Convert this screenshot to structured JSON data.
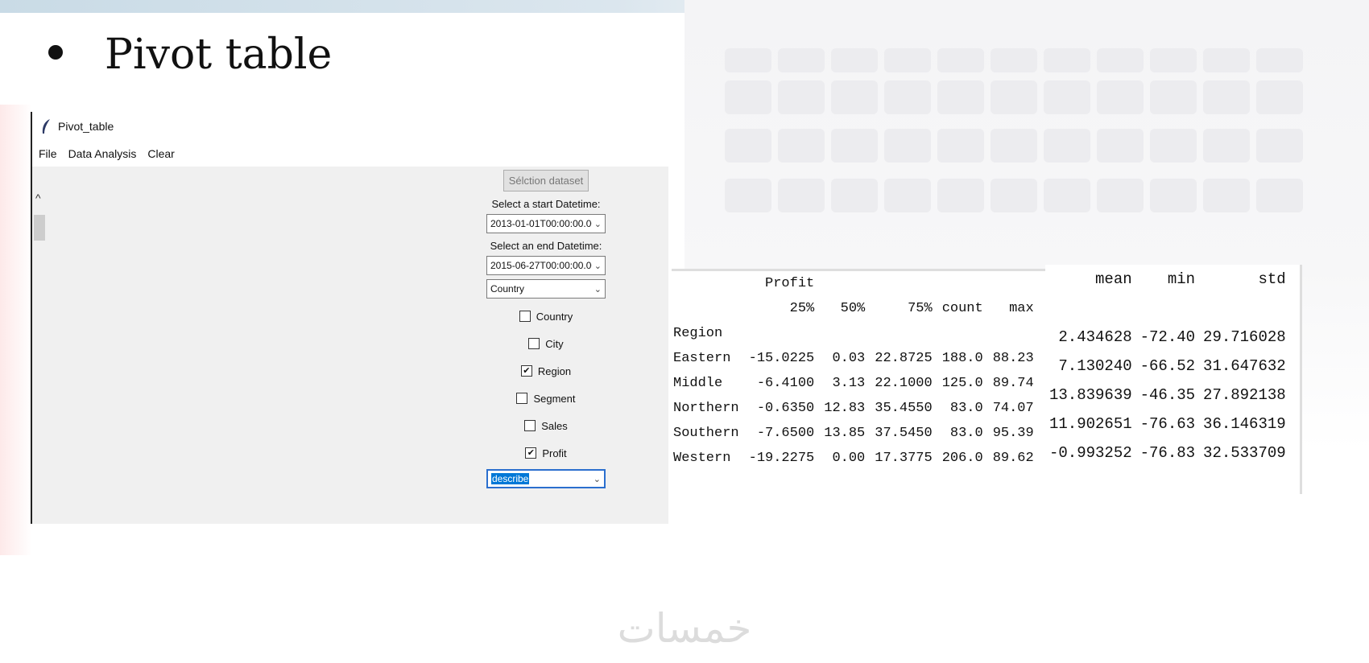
{
  "slide": {
    "title": "Pivot table"
  },
  "window": {
    "title": "Pivot_table",
    "menu": [
      "File",
      "Data Analysis",
      "Clear"
    ],
    "select_button": "Sélction dataset",
    "start_label": "Select a start Datetime:",
    "start_value": "2013-01-01T00:00:00.00",
    "end_label": "Select an end Datetime:",
    "end_value": "2015-06-27T00:00:00.00",
    "column_value": "Country",
    "checkboxes": [
      {
        "label": "Country",
        "checked": false
      },
      {
        "label": "City",
        "checked": false
      },
      {
        "label": "Region",
        "checked": true
      },
      {
        "label": "Segment",
        "checked": false
      },
      {
        "label": "Sales",
        "checked": false
      },
      {
        "label": "Profit",
        "checked": true
      }
    ],
    "function_value": "describe",
    "check_mark": "✔",
    "scroll_up": "^"
  },
  "output": {
    "header1": "Profit",
    "columns": [
      "25%",
      "50%",
      "75%",
      "count",
      "max"
    ],
    "index_name": "Region",
    "rows": [
      {
        "region": "Eastern",
        "values": [
          "-15.0225",
          "0.03",
          "22.8725",
          "188.0",
          "88.23"
        ]
      },
      {
        "region": "Middle",
        "values": [
          "-6.4100",
          "3.13",
          "22.1000",
          "125.0",
          "89.74"
        ]
      },
      {
        "region": "Northern",
        "values": [
          "-0.6350",
          "12.83",
          "35.4550",
          "83.0",
          "74.07"
        ]
      },
      {
        "region": "Southern",
        "values": [
          "-7.6500",
          "13.85",
          "37.5450",
          "83.0",
          "95.39"
        ]
      },
      {
        "region": "Western",
        "values": [
          "-19.2275",
          "0.00",
          "17.3775",
          "206.0",
          "89.62"
        ]
      }
    ]
  },
  "stats": {
    "columns": [
      "mean",
      "min",
      "std"
    ],
    "rows": [
      [
        "2.434628",
        "-72.40",
        "29.716028"
      ],
      [
        "7.130240",
        "-66.52",
        "31.647632"
      ],
      [
        "13.839639",
        "-46.35",
        "27.892138"
      ],
      [
        "11.902651",
        "-76.63",
        "36.146319"
      ],
      [
        "-0.993252",
        "-76.83",
        "32.533709"
      ]
    ]
  },
  "watermark": "خمسات"
}
